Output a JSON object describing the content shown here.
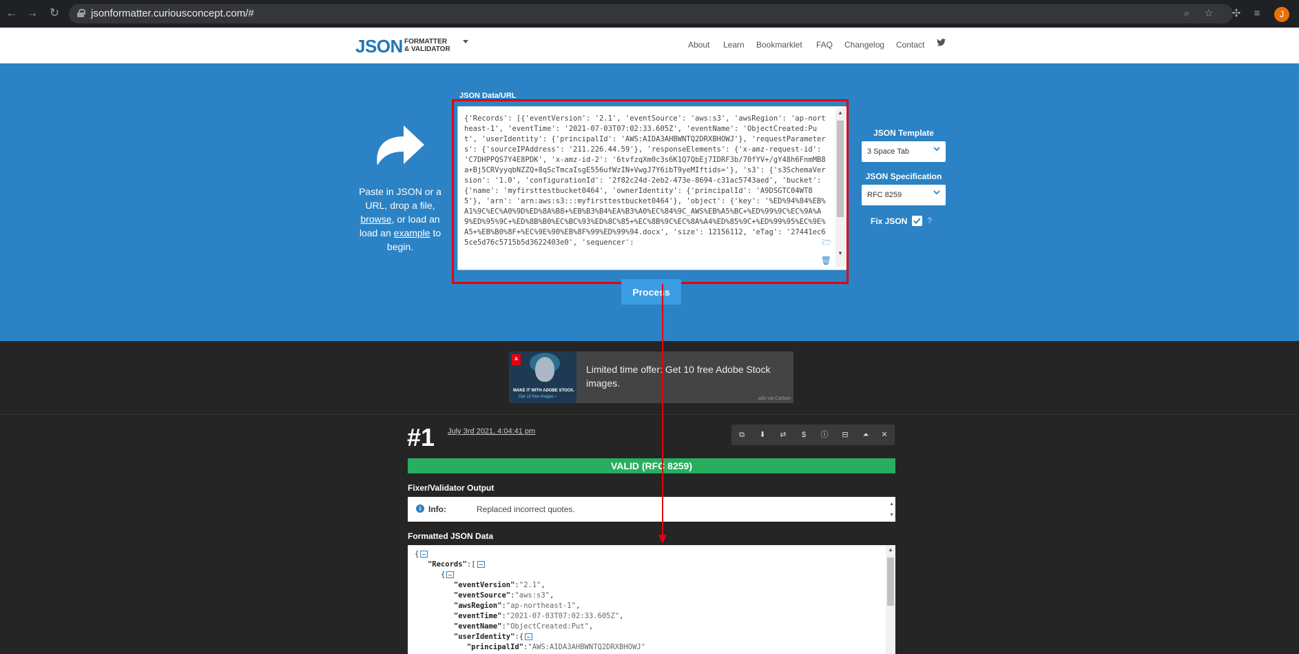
{
  "browser": {
    "url": "jsonformatter.curiousconcept.com/#",
    "avatar_letter": "J"
  },
  "header": {
    "logo_main": "JSON",
    "logo_sub_line1": "FORMATTER",
    "logo_sub_line2": "& VALIDATOR",
    "nav": [
      "About",
      "Learn",
      "Bookmarklet",
      "FAQ",
      "Changelog",
      "Contact"
    ]
  },
  "input": {
    "label": "JSON Data/URL",
    "paste_line1": "Paste in JSON or a",
    "paste_line2": "URL, drop a file,",
    "paste_browse": "browse",
    "paste_line3_rest": ", or load an",
    "paste_example": "example",
    "paste_line4_rest": " to begin.",
    "value": "{'Records': [{'eventVersion': '2.1', 'eventSource': 'aws:s3', 'awsRegion': 'ap-northeast-1', 'eventTime': '2021-07-03T07:02:33.605Z', 'eventName': 'ObjectCreated:Put', 'userIdentity': {'principalId': 'AWS:AIDA3AHBWNTQ2DRXBHOWJ'}, 'requestParameters': {'sourceIPAddress': '211.226.44.59'}, 'responseElements': {'x-amz-request-id': 'C7DHPPQS7Y4E8PDK', 'x-amz-id-2': '6tvfzqXm0c3s6K1Q7QbEj7IDRF3b/70fYV+/gY48h6FnmMB8a+Bj5CRVyyqbNZZQ+8qScTmcaIsgE556ufWzIN+VwgJ7Y6ibT9yeMIftids='}, 's3': {'s3SchemaVersion': '1.0', 'configurationId': '2f82c24d-2eb2-473e-8694-c31ac5743aed', 'bucket': {'name': 'myfirsttestbucket0464', 'ownerIdentity': {'principalId': 'A9DSGTC04WT85'}, 'arn': 'arn:aws:s3:::myfirsttestbucket0464'}, 'object': {'key': '%ED%94%84%EB%A1%9C%EC%A0%9D%ED%8A%B8+%EB%B3%B4%EA%B3%A0%EC%84%9C_AWS%EB%A5%BC+%ED%99%9C%EC%9A%A9%ED%95%9C+%ED%8B%B0%EC%BC%93%ED%8C%85+%EC%8B%9C%EC%8A%A4%ED%85%9C+%ED%99%95%EC%9E%A5+%EB%B0%8F+%EC%9E%90%EB%8F%99%ED%99%94.docx', 'size': 12156112, 'eTag': '27441ec65ce5d76c5715b5d3622403e0', 'sequencer':",
    "process_label": "Process"
  },
  "options": {
    "template_label": "JSON Template",
    "template_value": "3 Space Tab",
    "spec_label": "JSON Specification",
    "spec_value": "RFC 8259",
    "fix_label": "Fix JSON",
    "fix_checked": true,
    "help_glyph": "?"
  },
  "ad": {
    "text": "Limited time offer: Get 10 free Adobe Stock images.",
    "image_caption1": "MAKE IT WITH ADOBE STOCK.",
    "image_caption2": "Get 10 free images ›",
    "via": "ads via Carbon"
  },
  "result": {
    "number": "#1",
    "date": "July 3rd 2021, 4:04:41 pm",
    "status": "VALID (RFC 8259)",
    "status_color": "#27ae60",
    "output_title": "Fixer/Validator Output",
    "info_label": "Info:",
    "info_message": "Replaced incorrect quotes.",
    "formatted_title": "Formatted JSON Data"
  },
  "formatted_json": {
    "l1": "{",
    "k_records": "\"Records\"",
    "records_open": ":[",
    "l3": "{",
    "k_eventVersion": "\"eventVersion\"",
    "v_eventVersion": "\"2.1\"",
    "k_eventSource": "\"eventSource\"",
    "v_eventSource": "\"aws:s3\"",
    "k_awsRegion": "\"awsRegion\"",
    "v_awsRegion": "\"ap-northeast-1\"",
    "k_eventTime": "\"eventTime\"",
    "v_eventTime": "\"2021-07-03T07:02:33.605Z\"",
    "k_eventName": "\"eventName\"",
    "v_eventName": "\"ObjectCreated:Put\"",
    "k_userIdentity": "\"userIdentity\"",
    "userIdentity_open": ":{",
    "k_principalId": "\"principalId\"",
    "v_principalId": "\"AWS:AIDA3AHBWNTQ2DRXBHOWJ\""
  },
  "colors": {
    "accent": "#2b82c4",
    "annotation": "#e3000f",
    "valid": "#27ae60"
  }
}
